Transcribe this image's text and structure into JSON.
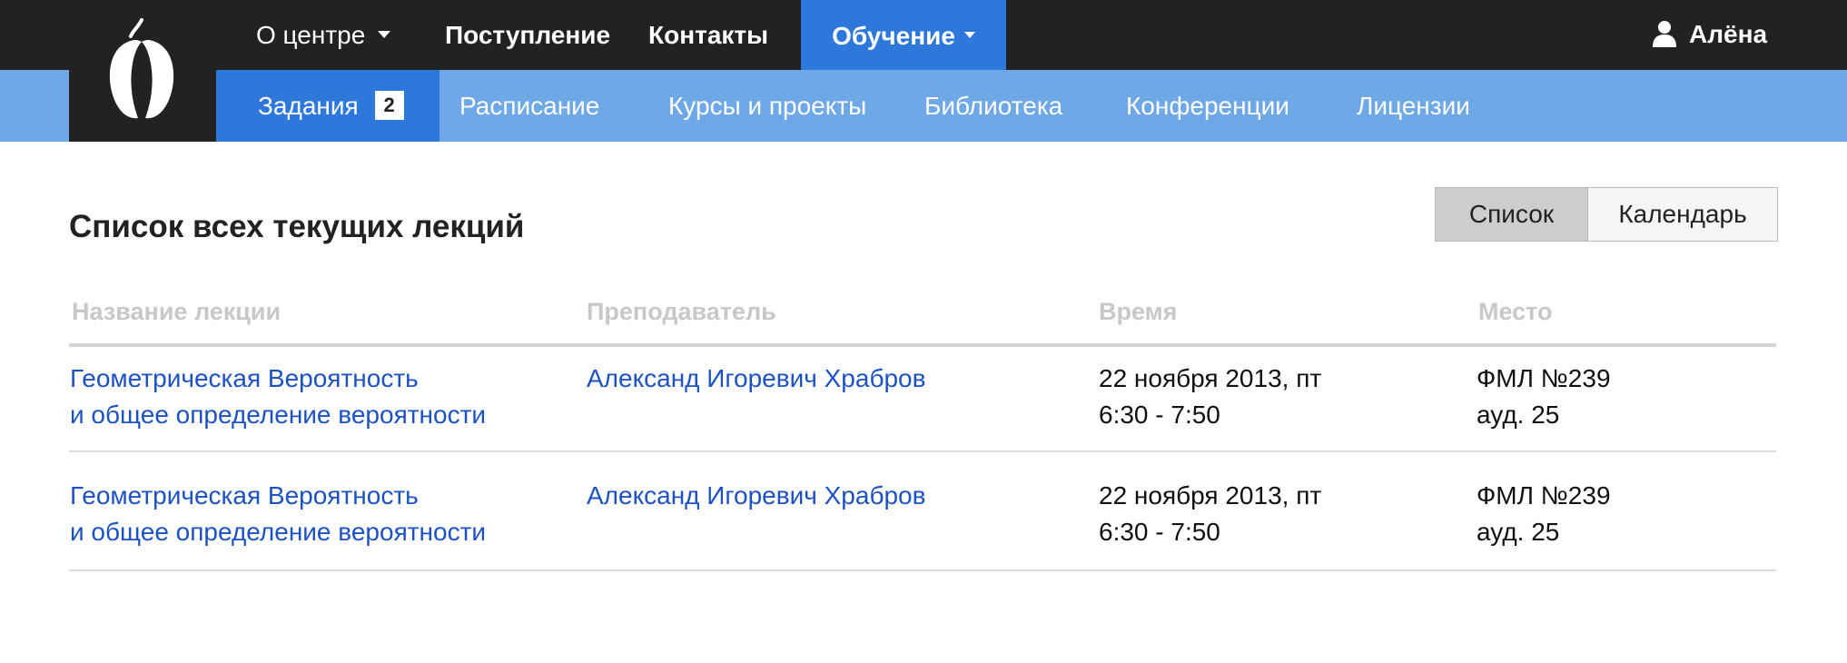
{
  "nav": {
    "items": [
      {
        "label": "О центре"
      },
      {
        "label": "Поступление"
      },
      {
        "label": "Контакты"
      }
    ],
    "active": {
      "label": "Обучение"
    },
    "user": {
      "name": "Алёна",
      "icon": "user-icon"
    }
  },
  "subnav": {
    "items": [
      {
        "label": "Задания",
        "badge": "2"
      },
      {
        "label": "Расписание"
      },
      {
        "label": "Курсы и проекты"
      },
      {
        "label": "Библиотека"
      },
      {
        "label": "Конференции"
      },
      {
        "label": "Лицензии"
      }
    ]
  },
  "page": {
    "title": "Список всех текущих лекций"
  },
  "view_toggle": {
    "list": "Список",
    "calendar": "Календарь",
    "selected": "Список"
  },
  "table": {
    "headers": {
      "name": "Название лекции",
      "teacher": "Преподаватель",
      "time": "Время",
      "place": "Место"
    },
    "rows": [
      {
        "name_line1": "Геометрическая Вероятность",
        "name_line2": "и общее определение вероятности",
        "teacher": "Александ Игоревич Храбров",
        "date": "22 ноября 2013, пт",
        "time": "6:30 - 7:50",
        "place_line1": "ФМЛ №239",
        "place_line2": "ауд. 25"
      },
      {
        "name_line1": "Геометрическая Вероятность",
        "name_line2": "и общее определение вероятности",
        "teacher": "Александ Игоревич Храбров",
        "date": "22 ноября 2013, пт",
        "time": "6:30 - 7:50",
        "place_line1": "ФМЛ №239",
        "place_line2": "ауд. 25"
      }
    ]
  },
  "colors": {
    "topbar": "#222222",
    "subbar": "#6fa8e6",
    "active": "#2e78dc",
    "link": "#1d52c4"
  }
}
